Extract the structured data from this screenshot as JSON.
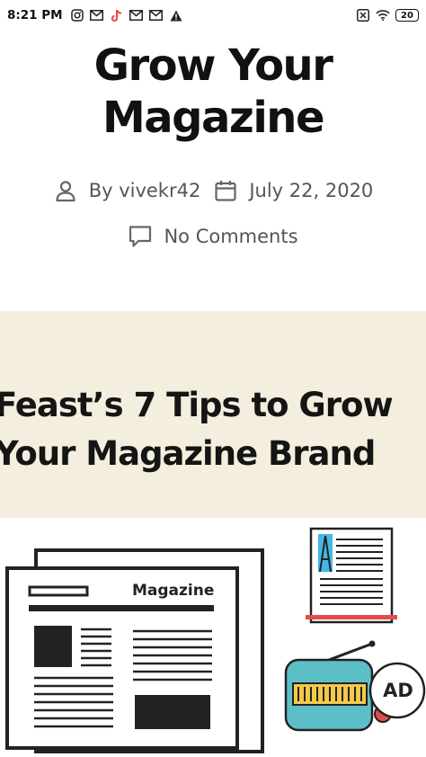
{
  "status_bar": {
    "time": "8:21 PM",
    "left_icons": [
      "instagram-icon",
      "gmail-icon",
      "tiktok-icon",
      "gmail-icon",
      "gmail-icon",
      "warning-icon"
    ],
    "right_icons": [
      "close-box-icon",
      "wifi-icon"
    ],
    "battery": "20"
  },
  "post": {
    "title": "Grow Your Magazine",
    "author": "By vivekr42",
    "date": "July 22, 2020",
    "comments": "No Comments"
  },
  "featured_image": {
    "banner_title_line1": "Feast’s 7 Tips to Grow",
    "banner_title_line2": "Your Magazine Brand",
    "magazine_label": "Magazine",
    "ad_label": "AD",
    "colors": {
      "banner_bg": "#f4eede",
      "doc_blue": "#45b7e6",
      "doc_red": "#e34c4c",
      "radio_teal": "#5cbfc8",
      "radio_yellow": "#f3c94b"
    }
  }
}
